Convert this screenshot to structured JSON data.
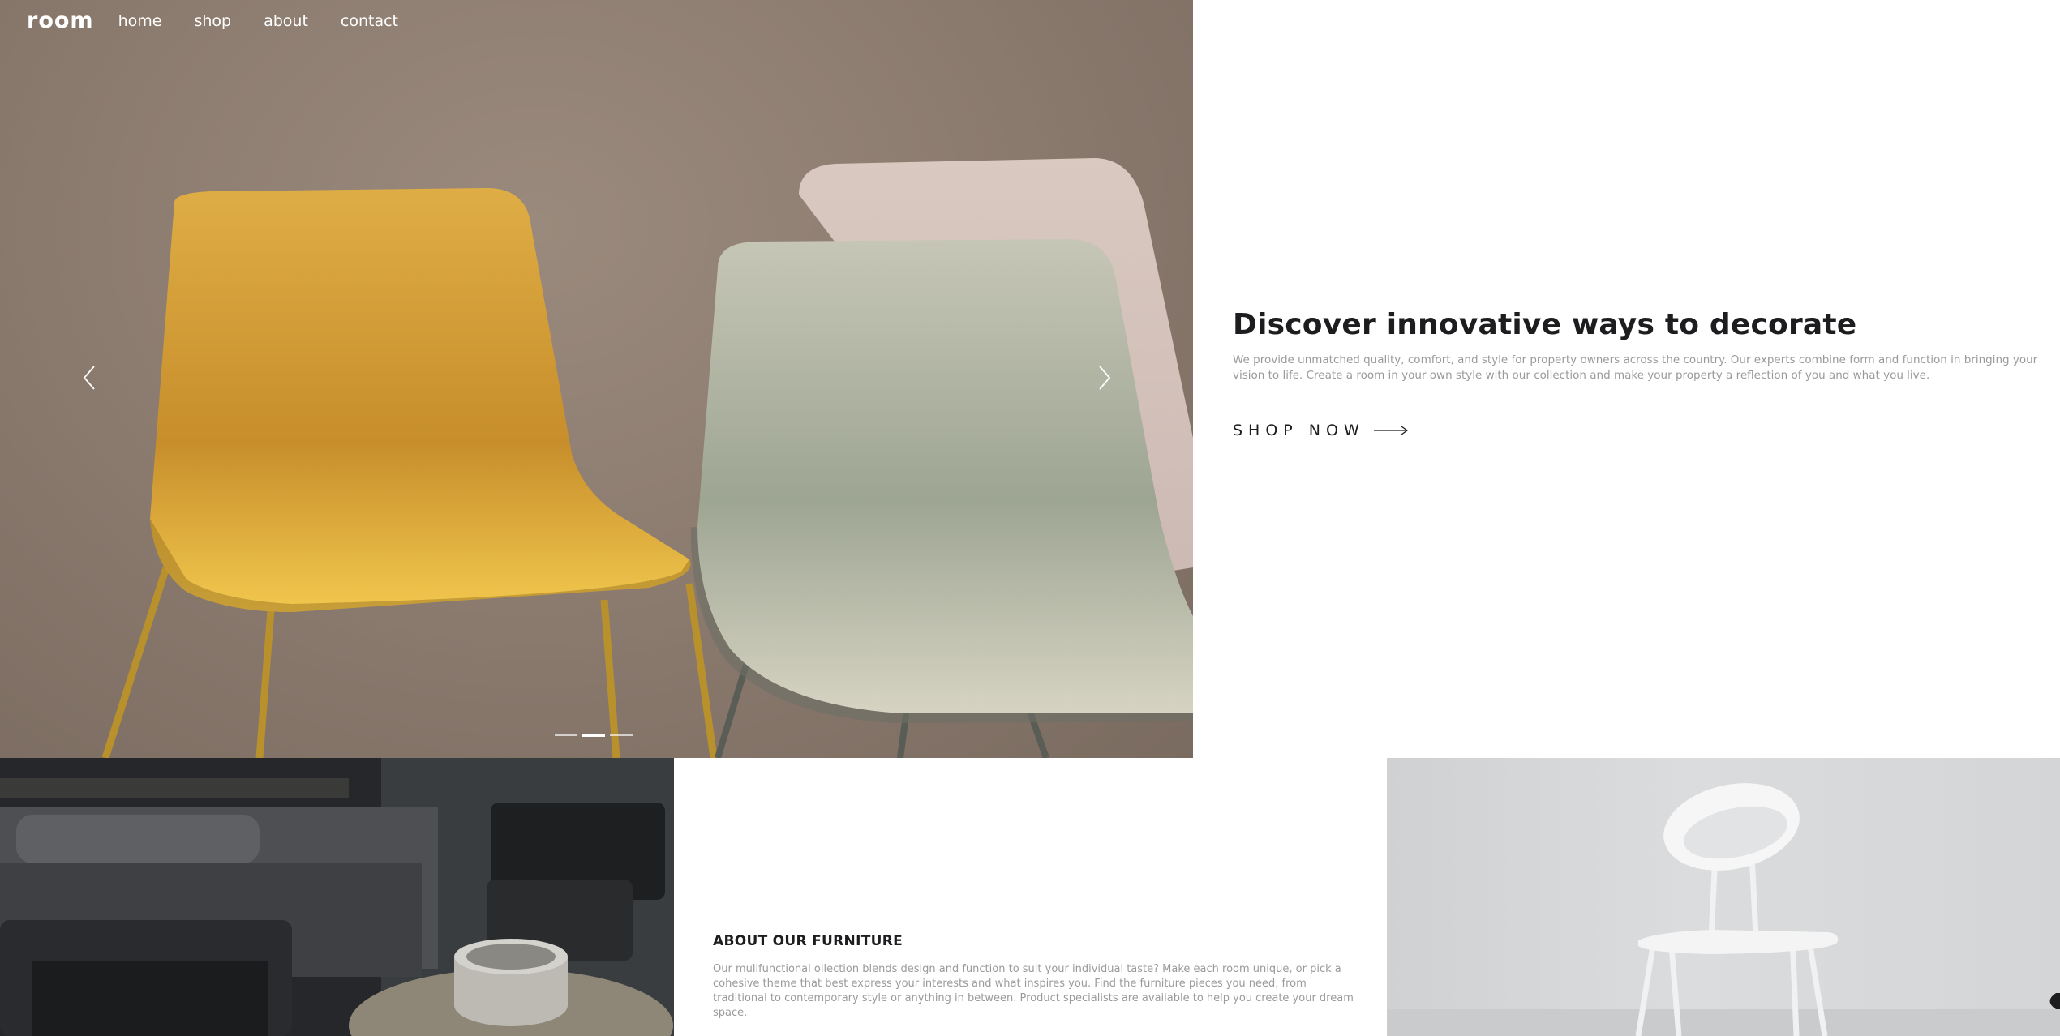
{
  "nav": {
    "logo": "room",
    "links": [
      "home",
      "shop",
      "about",
      "contact"
    ]
  },
  "slider": {
    "total_slides": 3,
    "active_slide": 2,
    "prev_icon": "chevron-left-icon",
    "next_icon": "chevron-right-icon"
  },
  "hero": {
    "title": "Discover innovative ways to decorate",
    "description": "We provide unmatched quality, comfort, and style for property owners across the country. Our experts combine form and function in bringing your vision to life. Create a room in your own style with our collection and make your property a reflection of you and what you live.",
    "cta_label": "SHOP NOW",
    "cta_icon": "arrow-right-icon"
  },
  "about": {
    "title": "ABOUT OUR FURNITURE",
    "description": "Our mulifunctional ollection blends design and function to suit your individual taste? Make each room unique, or pick a cohesive theme that best express your interests and what inspires you. Find the furniture pieces you need, from traditional to contemporary style or anything in between. Product specialists are available to help you create your dream space."
  },
  "colors": {
    "text_dark": "#1d1d1f",
    "text_muted": "#9a9a9a",
    "hero_wall": "#8d7c70",
    "chair_yellow": "#e0a838",
    "chair_sage": "#b4b7a6"
  }
}
